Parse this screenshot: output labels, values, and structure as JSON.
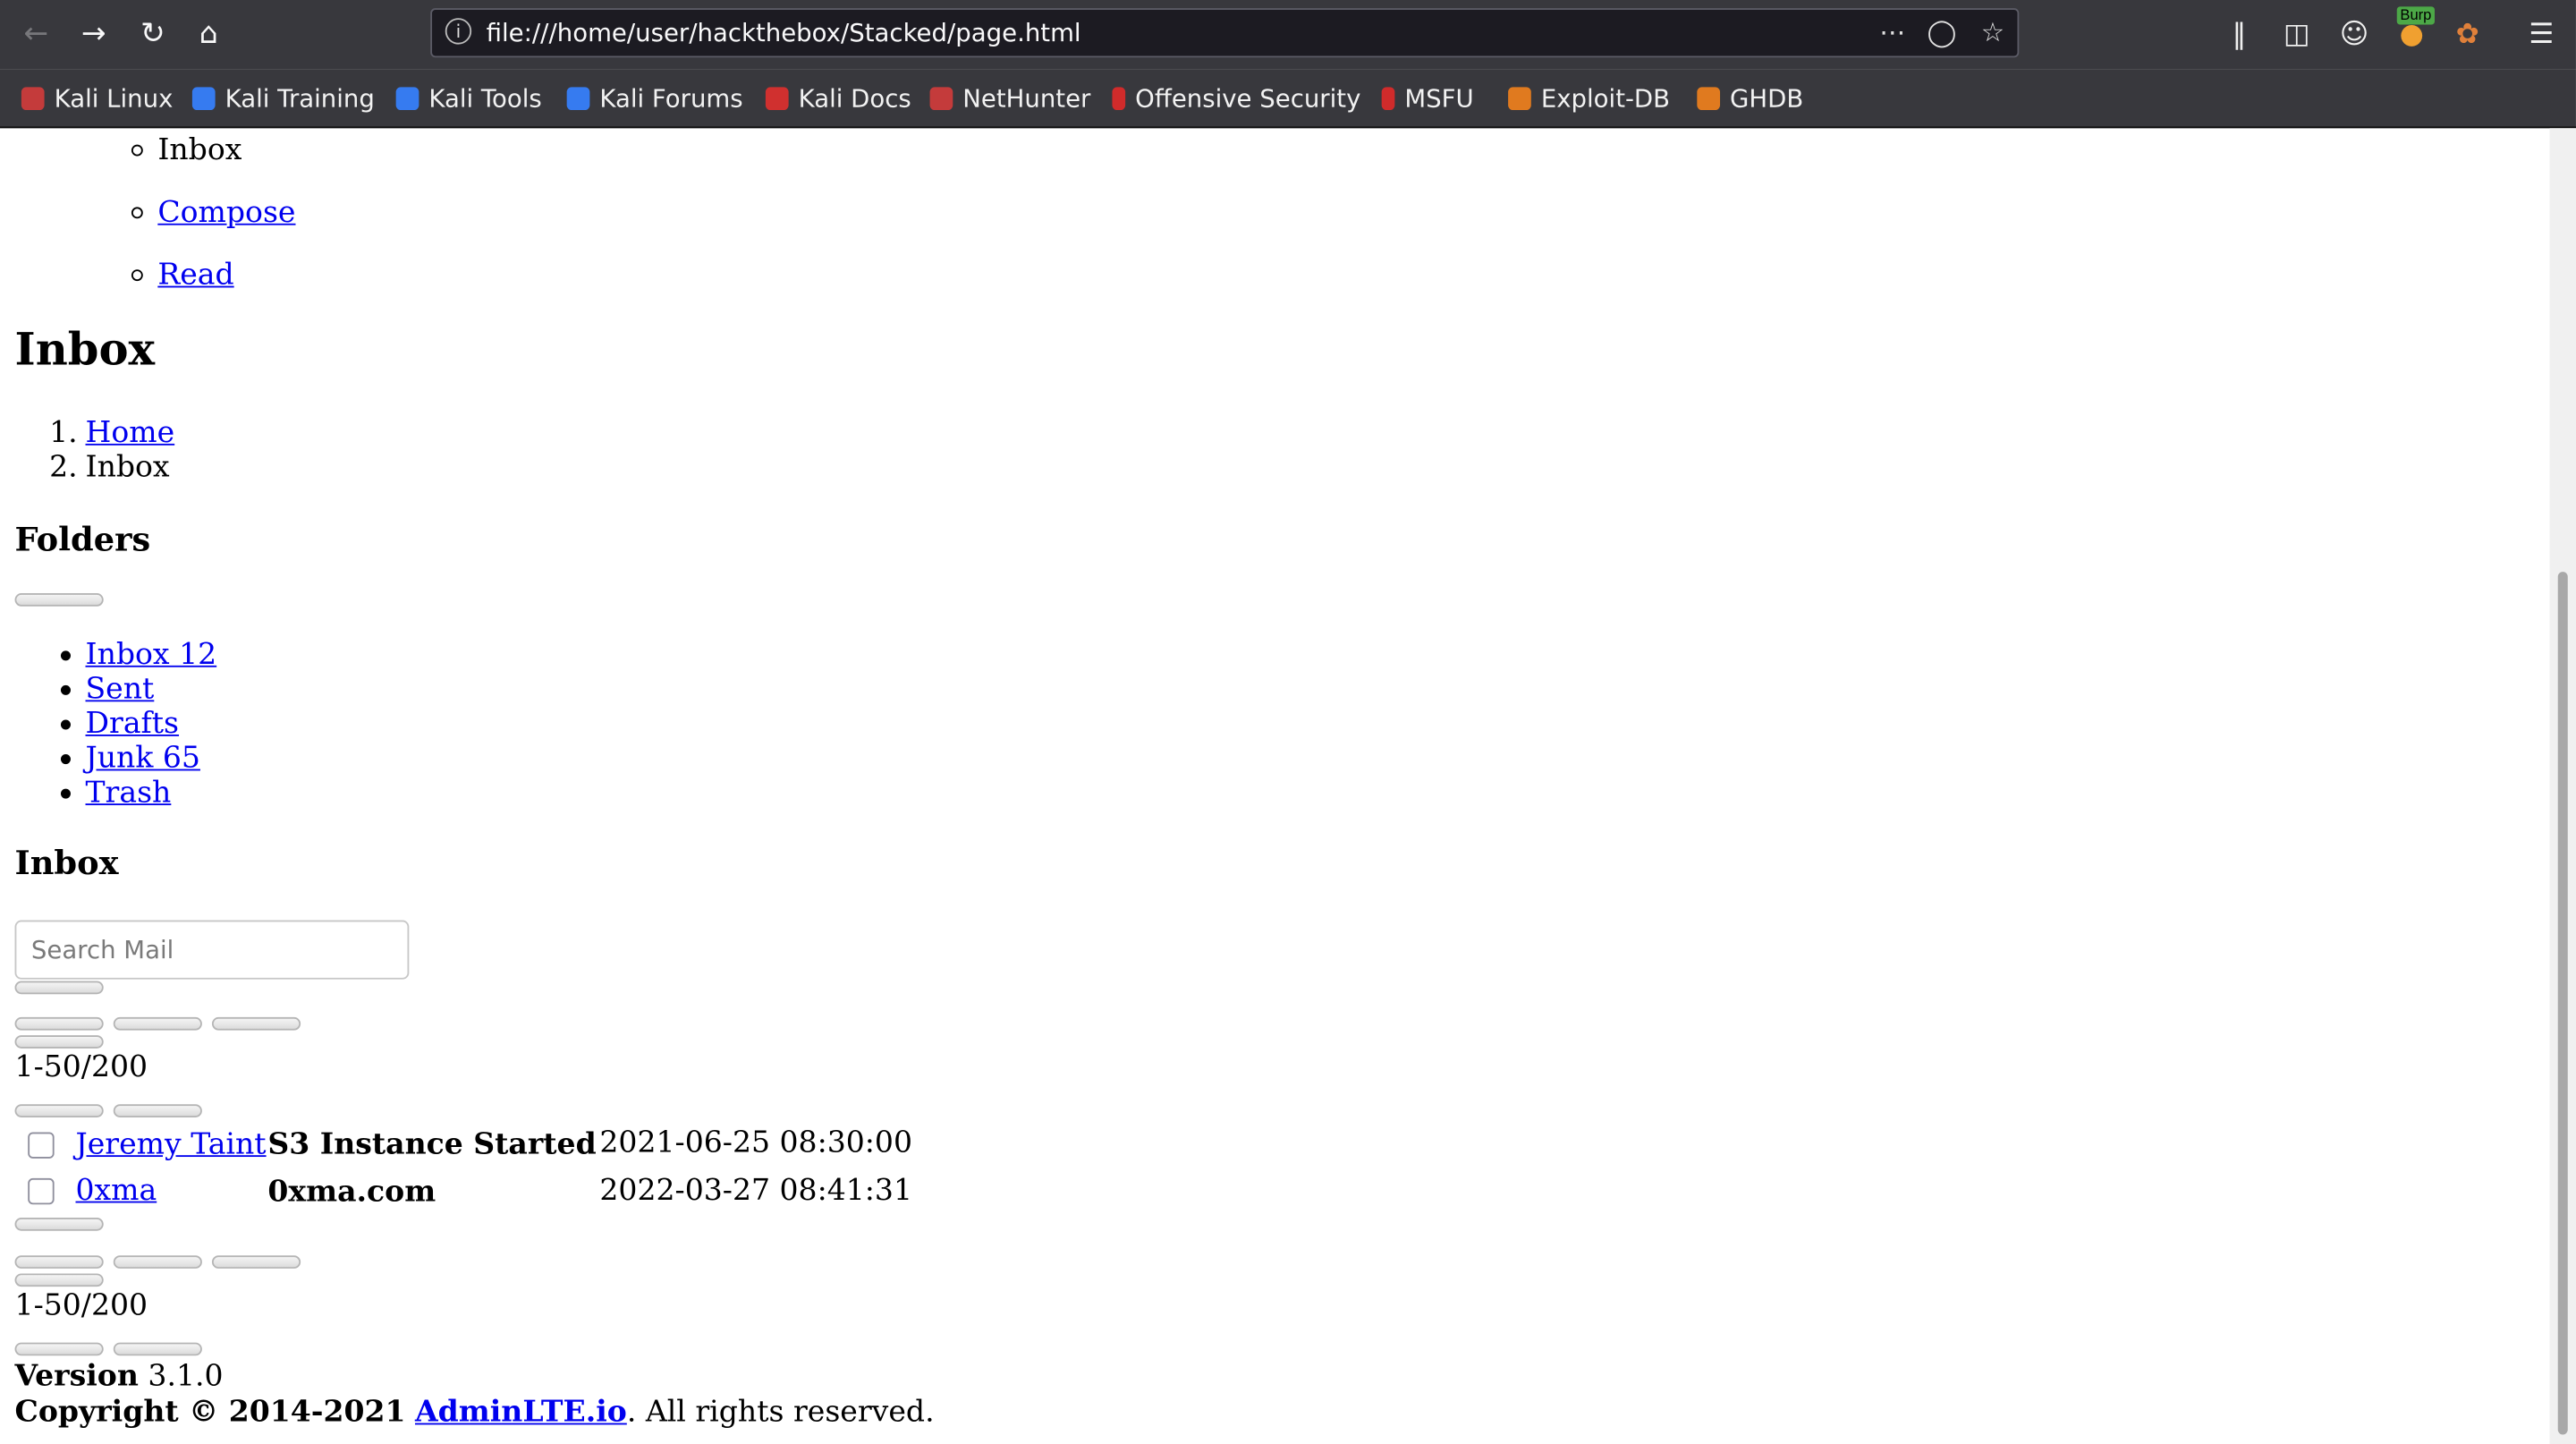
{
  "browser": {
    "url": "file:///home/user/hackthebox/Stacked/page.html",
    "burp_badge": "Burp",
    "bookmarks": [
      {
        "label": "Kali Linux",
        "icon": "kali-dragon-icon",
        "color": "#c43b3b"
      },
      {
        "label": "Kali Training",
        "icon": "kali-training-icon",
        "color": "#367bf0"
      },
      {
        "label": "Kali Tools",
        "icon": "kali-tools-icon",
        "color": "#367bf0"
      },
      {
        "label": "Kali Forums",
        "icon": "kali-forums-icon",
        "color": "#367bf0"
      },
      {
        "label": "Kali Docs",
        "icon": "kali-docs-icon",
        "color": "#d0302f"
      },
      {
        "label": "NetHunter",
        "icon": "nethunter-icon",
        "color": "#c43b3b"
      },
      {
        "label": "Offensive Security",
        "icon": "offsec-icon",
        "color": "#d02b2b"
      },
      {
        "label": "MSFU",
        "icon": "msfu-icon",
        "color": "#d02b2b"
      },
      {
        "label": "Exploit-DB",
        "icon": "exploitdb-icon",
        "color": "#e07a1f"
      },
      {
        "label": "GHDB",
        "icon": "ghdb-icon",
        "color": "#e07a1f"
      }
    ]
  },
  "nav": {
    "items": [
      "Inbox",
      "Compose",
      "Read"
    ]
  },
  "page": {
    "title": "Inbox",
    "breadcrumb": [
      "Home",
      "Inbox"
    ]
  },
  "folders": {
    "heading": "Folders",
    "items": [
      "Inbox 12",
      "Sent",
      "Drafts",
      "Junk 65",
      "Trash"
    ]
  },
  "inbox": {
    "heading": "Inbox",
    "search_placeholder": "Search Mail",
    "pagination": "1-50/200",
    "messages": [
      {
        "sender": "Jeremy Taint",
        "subject": "S3 Instance Started",
        "date": "2021-06-25 08:30:00"
      },
      {
        "sender": "0xma",
        "subject": "0xma.com",
        "date": "2022-03-27 08:41:31"
      }
    ]
  },
  "footer": {
    "version_label": "Version",
    "version": "3.1.0",
    "copyright_label": "Copyright © 2014-2021",
    "brand_link": "AdminLTE.io",
    "rights": ". All rights reserved."
  }
}
